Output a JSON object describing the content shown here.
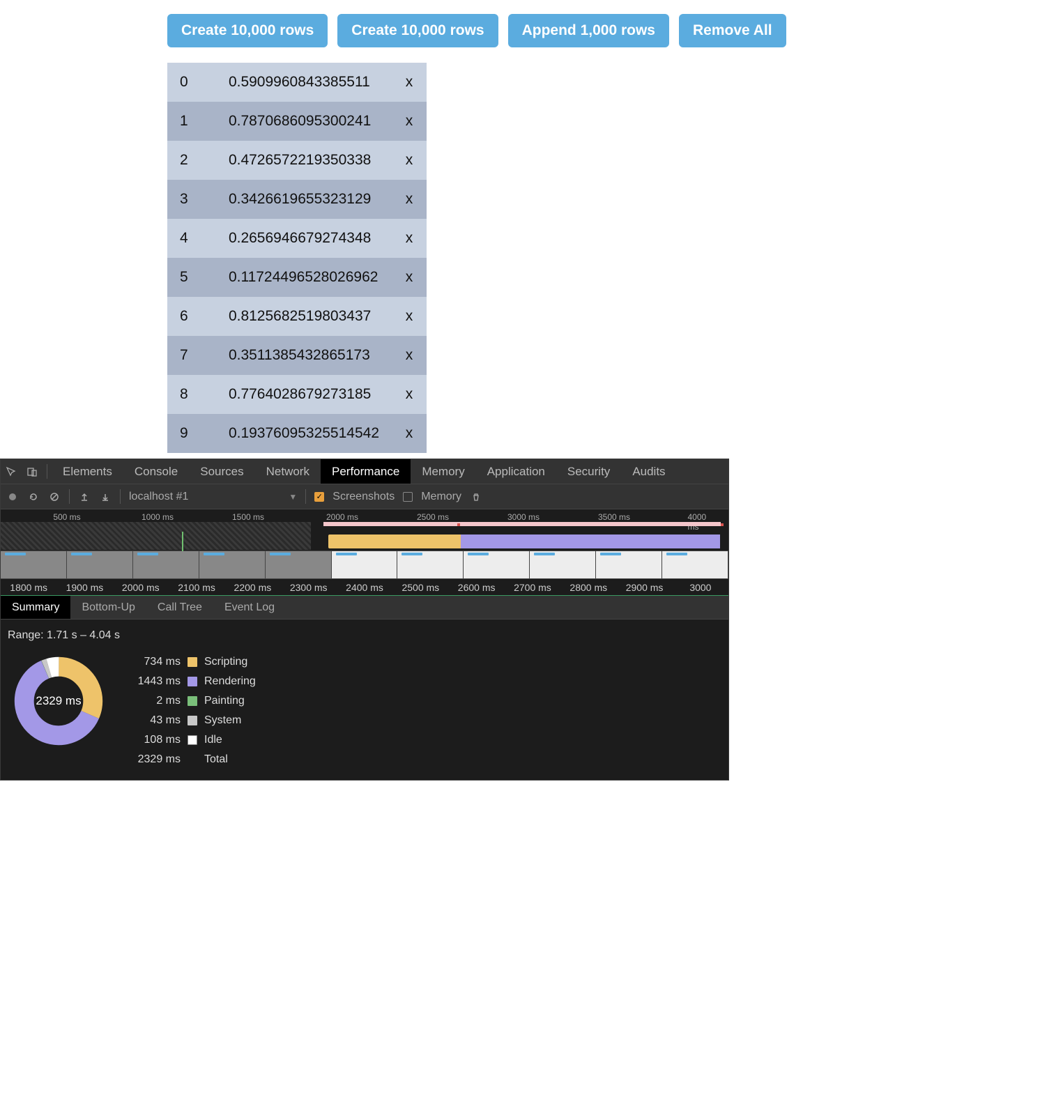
{
  "buttons": {
    "create1": "Create 10,000 rows",
    "create2": "Create 10,000 rows",
    "append": "Append 1,000 rows",
    "remove": "Remove All"
  },
  "rows": [
    {
      "idx": "0",
      "val": "0.5909960843385511",
      "del": "x"
    },
    {
      "idx": "1",
      "val": "0.7870686095300241",
      "del": "x"
    },
    {
      "idx": "2",
      "val": "0.4726572219350338",
      "del": "x"
    },
    {
      "idx": "3",
      "val": "0.3426619655323129",
      "del": "x"
    },
    {
      "idx": "4",
      "val": "0.2656946679274348",
      "del": "x"
    },
    {
      "idx": "5",
      "val": "0.11724496528026962",
      "del": "x"
    },
    {
      "idx": "6",
      "val": "0.8125682519803437",
      "del": "x"
    },
    {
      "idx": "7",
      "val": "0.3511385432865173",
      "del": "x"
    },
    {
      "idx": "8",
      "val": "0.7764028679273185",
      "del": "x"
    },
    {
      "idx": "9",
      "val": "0.19376095325514542",
      "del": "x"
    }
  ],
  "devtools": {
    "tabs": [
      "Elements",
      "Console",
      "Sources",
      "Network",
      "Performance",
      "Memory",
      "Application",
      "Security",
      "Audits"
    ],
    "active_tab": "Performance",
    "toolbar": {
      "profile_label": "localhost #1",
      "screenshots_label": "Screenshots",
      "memory_label": "Memory"
    },
    "overview_ticks": [
      "500 ms",
      "1000 ms",
      "1500 ms",
      "2000 ms",
      "2500 ms",
      "3000 ms",
      "3500 ms",
      "4000 ms"
    ],
    "detail_ticks": [
      "1800 ms",
      "1900 ms",
      "2000 ms",
      "2100 ms",
      "2200 ms",
      "2300 ms",
      "2400 ms",
      "2500 ms",
      "2600 ms",
      "2700 ms",
      "2800 ms",
      "2900 ms",
      "3000"
    ],
    "bottom_tabs": [
      "Summary",
      "Bottom-Up",
      "Call Tree",
      "Event Log"
    ],
    "active_bottom_tab": "Summary",
    "range_label": "Range: 1.71 s – 4.04 s",
    "legend": [
      {
        "val": "734 ms",
        "name": "Scripting",
        "color": "#eec36a"
      },
      {
        "val": "1443 ms",
        "name": "Rendering",
        "color": "#a398e7"
      },
      {
        "val": "2 ms",
        "name": "Painting",
        "color": "#7abf7a"
      },
      {
        "val": "43 ms",
        "name": "System",
        "color": "#c8c8c8"
      },
      {
        "val": "108 ms",
        "name": "Idle",
        "color": "#ffffff"
      },
      {
        "val": "2329 ms",
        "name": "Total",
        "color": ""
      }
    ],
    "donut_center": "2329 ms"
  },
  "chart_data": {
    "type": "pie",
    "title": "Summary",
    "series": [
      {
        "name": "Scripting",
        "value": 734,
        "color": "#eec36a"
      },
      {
        "name": "Rendering",
        "value": 1443,
        "color": "#a398e7"
      },
      {
        "name": "Painting",
        "value": 2,
        "color": "#7abf7a"
      },
      {
        "name": "System",
        "value": 43,
        "color": "#c8c8c8"
      },
      {
        "name": "Idle",
        "value": 108,
        "color": "#ffffff"
      }
    ],
    "total_ms": 2329,
    "range_start_s": 1.71,
    "range_end_s": 4.04
  }
}
